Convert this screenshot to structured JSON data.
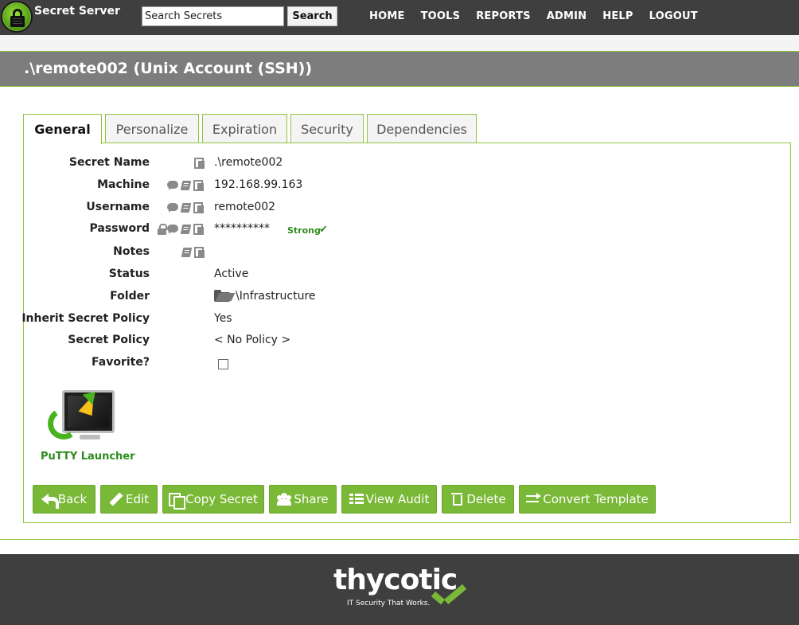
{
  "app": {
    "brand": "Secret Server",
    "logo_icon": "lock-icon"
  },
  "search": {
    "placeholder": "Search Secrets",
    "button_label": "Search"
  },
  "nav": {
    "items": [
      "HOME",
      "TOOLS",
      "REPORTS",
      "ADMIN",
      "HELP",
      "LOGOUT"
    ]
  },
  "page": {
    "title": ".\\remote002 (Unix Account (SSH))"
  },
  "tabs": {
    "items": [
      "General",
      "Personalize",
      "Expiration",
      "Security",
      "Dependencies"
    ],
    "active": "General"
  },
  "fields": {
    "secret_name": {
      "label": "Secret Name",
      "value": ".\\remote002"
    },
    "machine": {
      "label": "Machine",
      "value": "192.168.99.163"
    },
    "username": {
      "label": "Username",
      "value": "remote002"
    },
    "password": {
      "label": "Password",
      "value": "**********",
      "strength": "Strong"
    },
    "notes": {
      "label": "Notes",
      "value": ""
    },
    "status": {
      "label": "Status",
      "value": "Active"
    },
    "folder": {
      "label": "Folder",
      "value": "\\Infrastructure"
    },
    "inherit_secret_policy": {
      "label": "Inherit Secret Policy",
      "value": "Yes"
    },
    "secret_policy": {
      "label": "Secret Policy",
      "value": "< No Policy >"
    },
    "favorite": {
      "label": "Favorite?",
      "checked": false
    }
  },
  "launcher": {
    "label": "PuTTY Launcher"
  },
  "actions": {
    "back": "Back",
    "edit": "Edit",
    "copy_secret": "Copy Secret",
    "share": "Share",
    "view_audit": "View Audit",
    "delete": "Delete",
    "convert_template": "Convert Template"
  },
  "footer": {
    "logo_text": "thycotic",
    "tagline": "IT Security That Works."
  },
  "colors": {
    "accent_green": "#7ab837",
    "dark_bar": "#3f3f3f",
    "title_band": "#7d7d7d",
    "strong_green": "#2f8b1e"
  }
}
